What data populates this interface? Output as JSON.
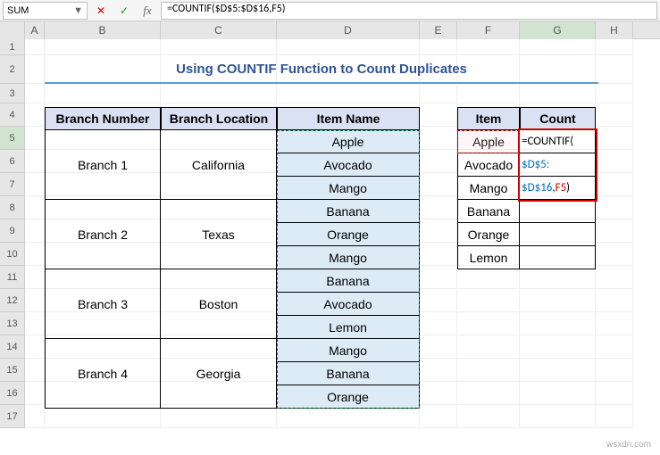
{
  "name_box": "SUM",
  "formula": "=COUNTIF($D$5:$D$16,F5)",
  "columns": [
    "A",
    "B",
    "C",
    "D",
    "E",
    "F",
    "G",
    "H"
  ],
  "row_numbers": [
    "1",
    "2",
    "3",
    "4",
    "5",
    "6",
    "7",
    "8",
    "9",
    "10",
    "11",
    "12",
    "13",
    "14",
    "15",
    "16",
    "17"
  ],
  "title": "Using COUNTIF Function to Count Duplicates",
  "main_headers": {
    "branch_number": "Branch Number",
    "branch_location": "Branch Location",
    "item_name": "Item Name"
  },
  "branches": [
    {
      "num": "Branch 1",
      "loc": "California",
      "items": [
        "Apple",
        "Avocado",
        "Mango"
      ]
    },
    {
      "num": "Branch 2",
      "loc": "Texas",
      "items": [
        "Banana",
        "Orange",
        "Mango"
      ]
    },
    {
      "num": "Branch 3",
      "loc": "Boston",
      "items": [
        "Banana",
        "Avocado",
        "Lemon"
      ]
    },
    {
      "num": "Branch 4",
      "loc": "Georgia",
      "items": [
        "Mango",
        "Banana",
        "Orange"
      ]
    }
  ],
  "side_headers": {
    "item": "Item",
    "count": "Count"
  },
  "side_items": [
    "Apple",
    "Avocado",
    "Mango",
    "Banana",
    "Orange",
    "Lemon"
  ],
  "formula_display": {
    "l1": "=COUNTIF(",
    "l2": "$D$5:",
    "l3_a": "$D$16",
    "l3_b": ",",
    "l3_c": "F5",
    "l3_d": ")"
  },
  "watermark": "wsxdn.com"
}
